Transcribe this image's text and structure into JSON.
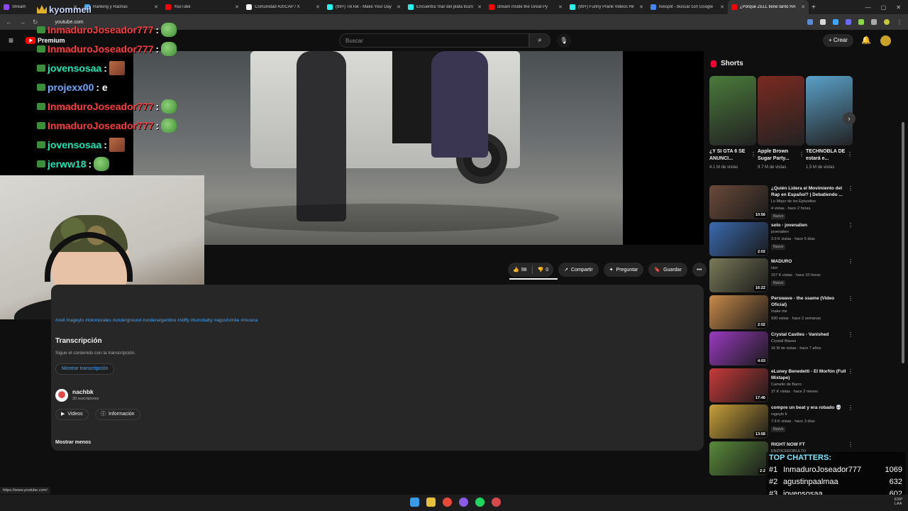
{
  "browser": {
    "tabs": [
      {
        "title": "Stream",
        "color": "#9146ff"
      },
      {
        "title": "Ranking y Rachas",
        "color": "#3ea6ff"
      },
      {
        "title": "YouTube",
        "color": "#ff0000"
      },
      {
        "title": "Comunidad 420CAP / X",
        "color": "#ffffff"
      },
      {
        "title": "(99+) TikTok - Make Your Day",
        "color": "#25f4ee"
      },
      {
        "title": "Encuentra 'mar del plata tours'",
        "color": "#25f4ee"
      },
      {
        "title": "stream inside the Great Py",
        "color": "#ff0000"
      },
      {
        "title": "(99+) Funny Prank Videos Hil",
        "color": "#25f4ee"
      },
      {
        "title": "livesplit - Buscar con Google",
        "color": "#4285f4"
      },
      {
        "title": "¿Porque ZELL tiene tanto HA",
        "color": "#ff0000"
      }
    ],
    "url": "youtube.com",
    "status_url": "https://www.youtube.com/"
  },
  "masthead": {
    "brand": "Premium",
    "search_placeholder": "Buscar",
    "create_label": "Crear"
  },
  "chat": {
    "overlay_user": "kyommeil",
    "messages": [
      {
        "user": "InmaduroJoseador777",
        "text": ":",
        "color": "#ff3b3b",
        "emote": "frog"
      },
      {
        "user": "InmaduroJoseador777",
        "text": ":",
        "color": "#ff3b3b",
        "emote": "frog"
      },
      {
        "user": "jovensosaa",
        "text": ":",
        "color": "#19e6b4",
        "emote": "face"
      },
      {
        "user": "projexx00",
        "text": ": e",
        "color": "#6ea8ff",
        "emote": ""
      },
      {
        "user": "InmaduroJoseador777",
        "text": ":",
        "color": "#ff3b3b",
        "emote": "frog"
      },
      {
        "user": "InmaduroJoseador777",
        "text": ":",
        "color": "#ff3b3b",
        "emote": "frog"
      },
      {
        "user": "jovensosaa",
        "text": ":",
        "color": "#19e6b4",
        "emote": "face"
      },
      {
        "user": "jerww18",
        "text": ":",
        "color": "#19e6b4",
        "emote": "frog"
      }
    ]
  },
  "actions": {
    "likes": "98",
    "dislikes": "0",
    "share": "Compartir",
    "ask": "Preguntar",
    "save": "Guardar"
  },
  "description": {
    "hashtags": "#zell #rageylo #lolomorales #underground #underargentino #stiffy #turrobaby #agusfornite #musica",
    "transcript_title": "Transcripción",
    "transcript_sub": "Sigue el contenido con la transcripción.",
    "transcript_button": "Mostrar transcripción",
    "channel_name": "nachbk",
    "channel_subs": "30 suscriptores",
    "videos_button": "Videos",
    "info_button": "Información",
    "show_less": "Mostrar menos"
  },
  "shorts": {
    "heading": "Shorts",
    "items": [
      {
        "title": "¿Y SI GTA 6 SE ANUNCI...",
        "views": "4.1 M de vistas",
        "color": "#4a7a3a"
      },
      {
        "title": "Apple Brown Sugar Party...",
        "views": "9.7 M de vistas",
        "color": "#7a2a20"
      },
      {
        "title": "TECHNOBLA DE estará e...",
        "views": "1.5 M de vistas",
        "color": "#5aa0c8"
      }
    ]
  },
  "recommendations": [
    {
      "title": "¿Quién Lidera el Movimiento del Rap en Español? | Debatiendo ...",
      "channel": "Lo Mejor de los Episodios",
      "meta": "4 vistas · hace 2 horas",
      "duration": "10:56",
      "new": "Nuevo",
      "color": "#6b4a3a"
    },
    {
      "title": "solo - jovenalien",
      "channel": "jovenalien",
      "meta": "3.5 K vistas · hace 5 días",
      "duration": "2:02",
      "new": "Nuevo",
      "color": "#3a6ab0"
    },
    {
      "title": "MADURO",
      "channel": "Idor",
      "meta": "157 K vistas · hace 10 horas",
      "duration": "16:22",
      "new": "Nuevo",
      "color": "#7a7a5a"
    },
    {
      "title": "Perswave - the ssame (Video Oficial)",
      "channel": "make me",
      "meta": "930 vistas · hace 2 semanas",
      "duration": "2:02",
      "new": "",
      "color": "#c88a4a"
    },
    {
      "title": "Crystal Castles - Vanished",
      "channel": "Crystal Waves",
      "meta": "16 M de vistas · hace 7 años",
      "duration": "4:03",
      "new": "",
      "color": "#9a3ac0"
    },
    {
      "title": "eLuney Benedetti - El Morfón (Full Mixtape)",
      "channel": "Camello de Barro",
      "meta": "37 K vistas · hace 2 meses",
      "duration": "17:46",
      "new": "",
      "color": "#c83a3a"
    },
    {
      "title": "compre un beat y era robado 💀",
      "channel": "rageylo fr",
      "meta": "7.6 K vistas · hace 3 días",
      "duration": "13:58",
      "new": "Nuevo",
      "color": "#c8a03a"
    },
    {
      "title": "RIGHT NOW FT",
      "channel": "ENZOCEROBULTO",
      "meta": "",
      "duration": "2:2",
      "new": "",
      "color": "#5a8a3a"
    }
  ],
  "top_chatters": {
    "title": "TOP CHATTERS:",
    "rows": [
      {
        "rank": "#1",
        "name": "InmaduroJoseador777",
        "count": "1069"
      },
      {
        "rank": "#2",
        "name": "agustinpaalmaa",
        "count": "632"
      },
      {
        "rank": "#3",
        "name": "jovensosaa",
        "count": "602"
      }
    ]
  },
  "taskbar": {
    "lang": "ESP",
    "region": "LAA"
  }
}
